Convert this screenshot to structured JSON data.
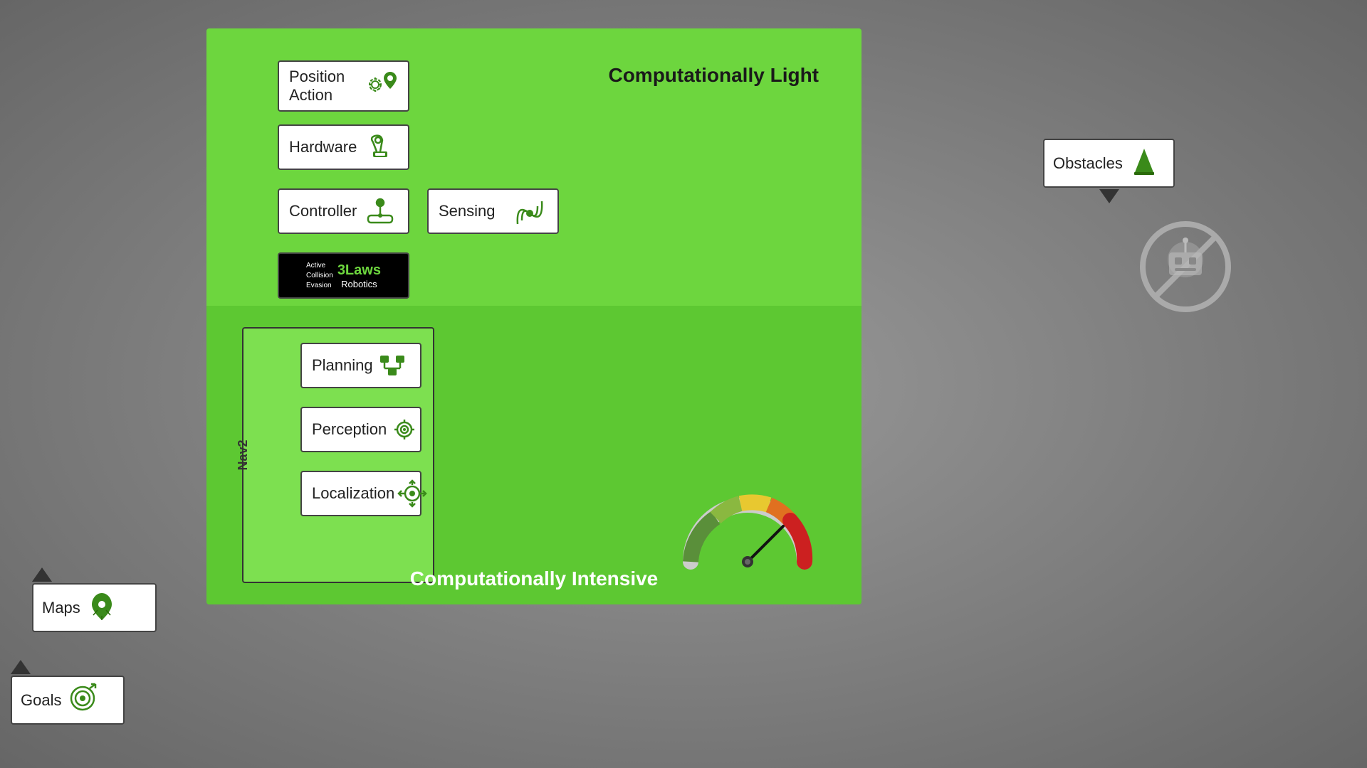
{
  "layout": {
    "upper_label": "Computationally Light",
    "lower_label": "Computationally Intensive"
  },
  "components": {
    "position_action": {
      "label": "Position Action",
      "icon": "gear-location-icon"
    },
    "hardware": {
      "label": "Hardware",
      "icon": "robot-arm-icon"
    },
    "controller": {
      "label": "Controller",
      "icon": "joystick-icon"
    },
    "sensing": {
      "label": "Sensing",
      "icon": "signal-icon"
    },
    "laws_active": "Active Collision Evasion",
    "laws_brand": "3Laws",
    "laws_sub": "Robotics",
    "planning": {
      "label": "Planning",
      "icon": "planning-icon"
    },
    "perception": {
      "label": "Perception",
      "icon": "perception-icon"
    },
    "localization": {
      "label": "Localization",
      "icon": "localization-icon"
    }
  },
  "external": {
    "obstacles": {
      "label": "Obstacles",
      "icon": "cone-icon"
    },
    "maps": {
      "label": "Maps",
      "icon": "maps-icon"
    },
    "goals": {
      "label": "Goals",
      "icon": "goals-icon"
    }
  },
  "nav2_label": "Nav2"
}
